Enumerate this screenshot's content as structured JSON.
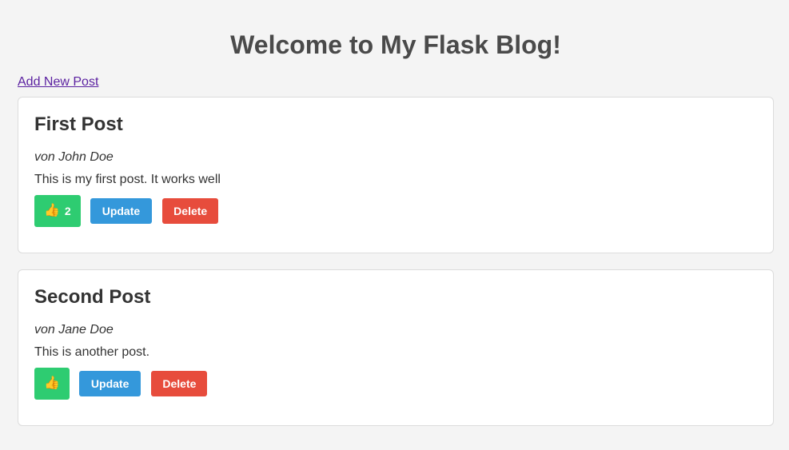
{
  "header": {
    "title": "Welcome to My Flask Blog!"
  },
  "nav": {
    "add_post_label": "Add New Post"
  },
  "posts": [
    {
      "title": "First Post",
      "author": "von John Doe",
      "content": "This is my first post. It works well",
      "like_icon": "thumbs-up",
      "likes": "2",
      "update_label": "Update",
      "delete_label": "Delete"
    },
    {
      "title": "Second Post",
      "author": "von Jane Doe",
      "content": "This is another post.",
      "like_icon": "thumbs-up",
      "likes": "",
      "update_label": "Update",
      "delete_label": "Delete"
    }
  ],
  "colors": {
    "background": "#f4f4f4",
    "like": "#2ecc71",
    "update": "#3498db",
    "delete": "#e74c3c",
    "link": "#5a1fa0"
  }
}
